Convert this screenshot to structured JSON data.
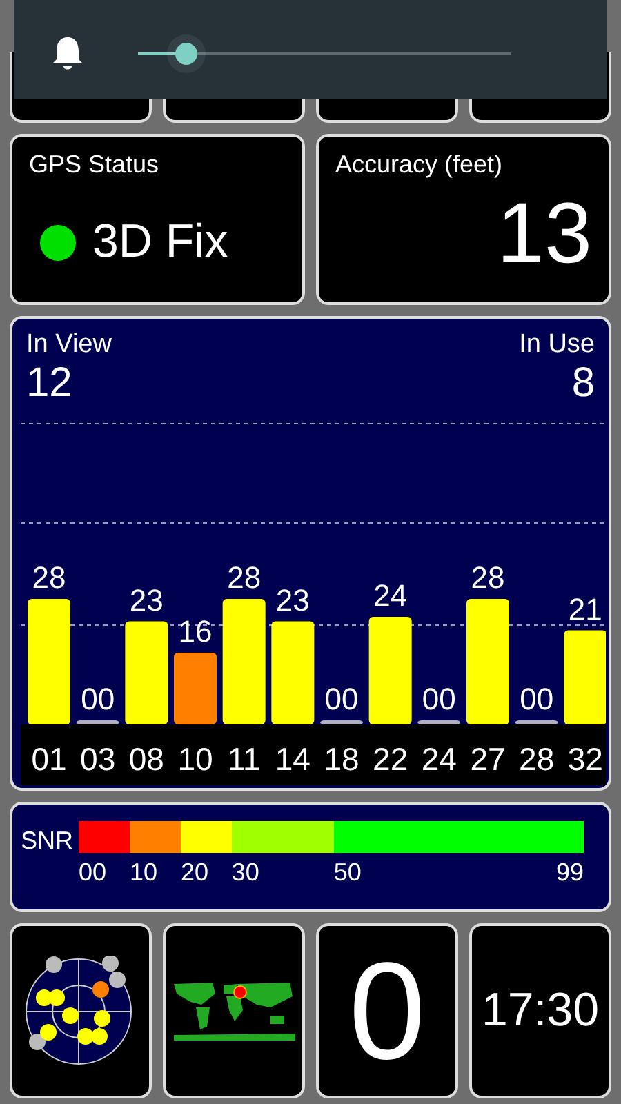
{
  "volume_panel": {
    "level": 0.13
  },
  "gps_status": {
    "title": "GPS Status",
    "fix": "3D Fix",
    "color": "#00e000"
  },
  "accuracy": {
    "title": "Accuracy (feet)",
    "value": "13"
  },
  "satellites": {
    "in_view_label": "In View",
    "in_view": "12",
    "in_use_label": "In Use",
    "in_use": "8",
    "chart_data": {
      "type": "bar",
      "categories": [
        "01",
        "03",
        "08",
        "10",
        "11",
        "14",
        "18",
        "22",
        "24",
        "27",
        "28",
        "32"
      ],
      "values": [
        28,
        0,
        23,
        16,
        28,
        23,
        0,
        24,
        0,
        28,
        0,
        21
      ],
      "value_labels": [
        "28",
        "00",
        "23",
        "16",
        "28",
        "23",
        "00",
        "24",
        "00",
        "28",
        "00",
        "21"
      ]
    }
  },
  "snr": {
    "label": "SNR",
    "scale": [
      {
        "label": "00",
        "color": "#ff0000"
      },
      {
        "label": "10",
        "color": "#ff8000"
      },
      {
        "label": "20",
        "color": "#ffff00"
      },
      {
        "label": "30",
        "color": "#a0ff00"
      },
      {
        "label": "50",
        "color": "#00ff00"
      },
      {
        "label": "99"
      }
    ]
  },
  "bottom_tiles": [
    {
      "kind": "radar"
    },
    {
      "kind": "map"
    },
    {
      "kind": "number",
      "text": "0"
    },
    {
      "kind": "time",
      "text": "17:30"
    }
  ]
}
